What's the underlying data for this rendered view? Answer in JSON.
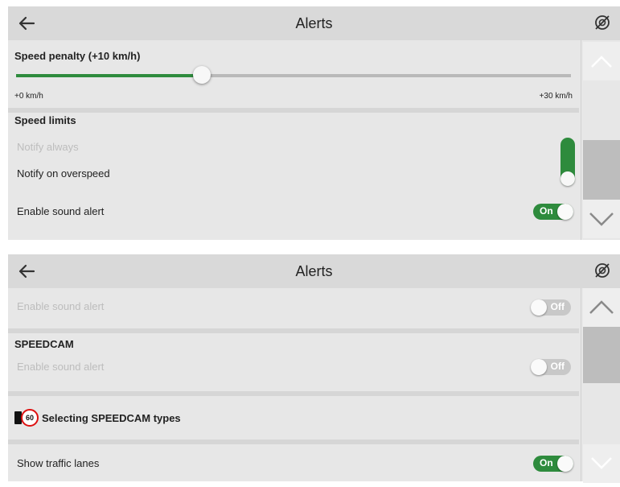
{
  "screen1": {
    "title": "Alerts",
    "speed_penalty": {
      "label": "Speed penalty (+10 km/h)",
      "min_label": "+0 km/h",
      "max_label": "+30 km/h",
      "value_fraction": 0.333
    },
    "speed_limits": {
      "heading": "Speed limits",
      "option_always": "Notify always",
      "option_overspeed": "Notify on overspeed",
      "selected": "Notify on overspeed"
    },
    "sound_alert": {
      "label": "Enable sound alert",
      "toggle": "On"
    }
  },
  "screen2": {
    "title": "Alerts",
    "sound_alert": {
      "label": "Enable sound alert",
      "toggle": "Off"
    },
    "speedcam": {
      "heading": "SPEEDCAM",
      "sound_label": "Enable sound alert",
      "toggle": "Off"
    },
    "speedcam_types": {
      "label": "Selecting SPEEDCAM types",
      "sign_value": "60"
    },
    "traffic_lanes": {
      "label": "Show traffic lanes",
      "toggle": "On"
    }
  },
  "colors": {
    "accent": "#2e8b3d",
    "background": "#e7e7e7",
    "header": "#d9d9d9",
    "disabled_text": "#bdbdbd"
  },
  "icons": {
    "back": "arrow-left",
    "gps": "gps-off",
    "scroll_up": "chevron-up",
    "scroll_down": "chevron-down",
    "speedcam": "speed-camera"
  }
}
